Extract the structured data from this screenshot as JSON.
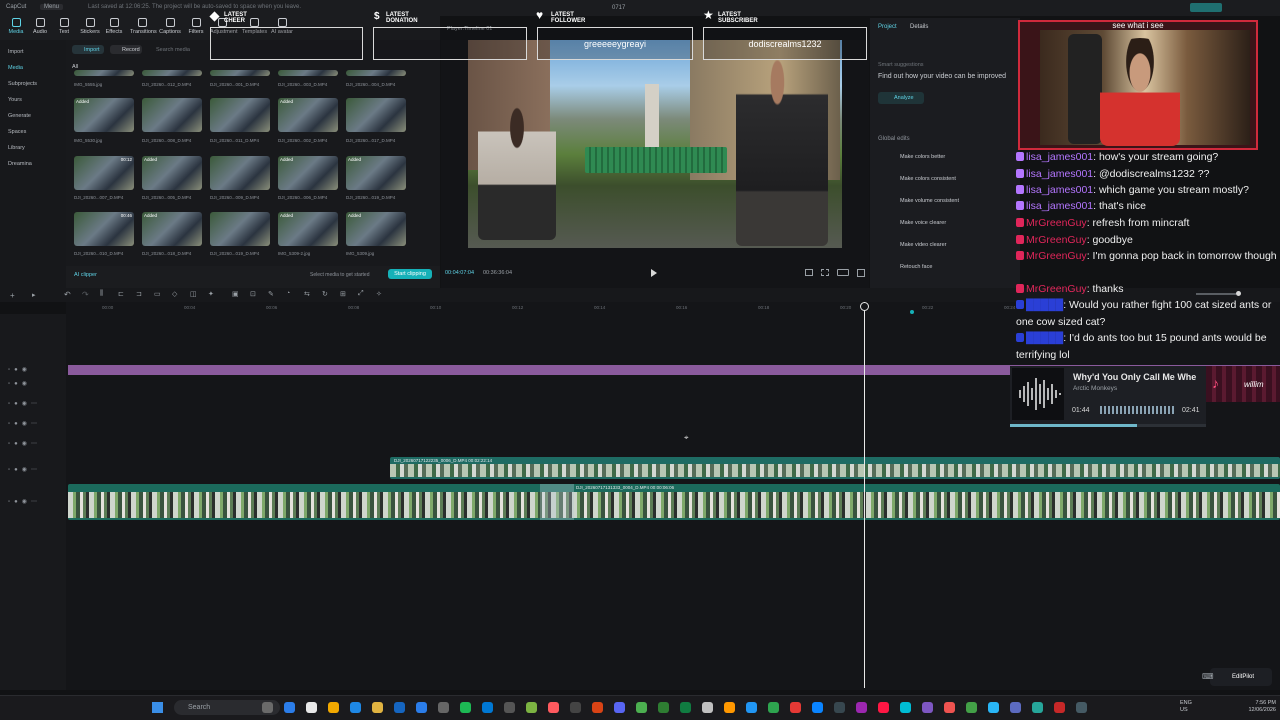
{
  "titlebar": {
    "app_name": "CapCut",
    "menu_label": "Menu",
    "notice": "Last saved at 12:06:25. The project will be auto-saved to space when you leave.",
    "timecode_small": "0717"
  },
  "toolbar": {
    "items": [
      "Media",
      "Audio",
      "Text",
      "Stickers",
      "Effects",
      "Transitions",
      "Captions",
      "Filters",
      "Adjustment",
      "Templates",
      "AI avatar"
    ]
  },
  "leftnav": {
    "items": [
      "Import",
      "Media",
      "Subprojects",
      "Yours",
      "Generate",
      "Spaces",
      "Library",
      "Dreamina"
    ]
  },
  "media": {
    "import_label": "Import",
    "record_label": "Record",
    "search_placeholder": "Search media",
    "filter_all": "All",
    "ai_clipper": "AI clipper",
    "select_hint": "Select media to get started",
    "start_clipping": "Start clipping",
    "thumbs": [
      {
        "caption": "IMG_5555.jpg",
        "tag": "",
        "dur": ""
      },
      {
        "caption": "DJI_20260...012_D.MP4",
        "tag": "",
        "dur": ""
      },
      {
        "caption": "DJI_20260...001_D.MP4",
        "tag": "",
        "dur": ""
      },
      {
        "caption": "DJI_20260...003_D.MP4",
        "tag": "",
        "dur": ""
      },
      {
        "caption": "DJI_20260...004_D.MP4",
        "tag": "",
        "dur": ""
      },
      {
        "caption": "IMG_5530.jpg",
        "tag": "Added",
        "dur": ""
      },
      {
        "caption": "DJI_20260...008_D.MP4",
        "tag": "",
        "dur": ""
      },
      {
        "caption": "DJI_20260...011_D.MP4",
        "tag": "",
        "dur": ""
      },
      {
        "caption": "DJI_20260...002_D.MP4",
        "tag": "Added",
        "dur": ""
      },
      {
        "caption": "DJI_20260...017_D.MP4",
        "tag": "",
        "dur": ""
      },
      {
        "caption": "DJI_20260...007_D.MP4",
        "tag": "",
        "dur": "00:12"
      },
      {
        "caption": "DJI_20260...005_D.MP4",
        "tag": "Added",
        "dur": ""
      },
      {
        "caption": "DJI_20260...009_D.MP4",
        "tag": "",
        "dur": ""
      },
      {
        "caption": "DJI_20260...006_D.MP4",
        "tag": "Added",
        "dur": ""
      },
      {
        "caption": "DJI_20260...019_D.MP4",
        "tag": "Added",
        "dur": ""
      },
      {
        "caption": "DJI_20260...010_D.MP4",
        "tag": "",
        "dur": "00:46"
      },
      {
        "caption": "DJI_20260...018_D.MP4",
        "tag": "Added",
        "dur": ""
      },
      {
        "caption": "DJI_20260...019_D.MP4",
        "tag": "",
        "dur": ""
      },
      {
        "caption": "IMG_5309-2.jpg",
        "tag": "Added",
        "dur": ""
      },
      {
        "caption": "IMG_5309.jpg",
        "tag": "Added",
        "dur": ""
      }
    ]
  },
  "player": {
    "title": "Player:Timeline 01",
    "current_time": "00:04:07:04",
    "total_time": "00:36:36:04"
  },
  "props": {
    "tab_project": "Project",
    "tab_details": "Details",
    "smart_suggestions": "Smart suggestions",
    "find_out": "Find out how your video can be improved",
    "analyze": "Analyze",
    "global_edits": "Global edits",
    "edits": [
      "Make colors better",
      "Make colors consistent",
      "Make volume consistent",
      "Make voice clearer",
      "Make video clearer",
      "Retouch face"
    ]
  },
  "timeline": {
    "clip1_label": "DJI_20260717122235_0006_D.MP4   00:02:22:14",
    "clip2_label": "DJI_20260717131333_0004_D.MP4   00:00:06:06",
    "ruler": [
      "00:00",
      "00:04",
      "00:06",
      "00:08",
      "00:10",
      "00:12",
      "00:14",
      "00:16",
      "00:18",
      "00:20",
      "00:22",
      "00:24"
    ]
  },
  "overlays": {
    "cheer_label": "LATEST CHEER",
    "donation_label": "LATEST DONATION",
    "follower_label": "LATEST FOLLOWER",
    "follower_value": "greeeeeygreayi",
    "subscriber_label": "LATEST SUBSCRIBER",
    "subscriber_value": "dodiscrealms1232",
    "webcam_caption": "see what i see"
  },
  "chat": [
    {
      "user": "lisa_james001",
      "badge": "",
      "msg": "how's your stream going?",
      "color": "#b476ff"
    },
    {
      "user": "lisa_james001",
      "badge": "",
      "msg": "@dodiscrealms1232 ??",
      "color": "#b476ff"
    },
    {
      "user": "lisa_james001",
      "badge": "",
      "msg": "which game you stream mostly?",
      "color": "#b476ff"
    },
    {
      "user": "lisa_james001",
      "badge": "",
      "msg": "that's nice",
      "color": "#b476ff"
    },
    {
      "user": "MrGreenGuy",
      "badge": "",
      "msg": "refresh from mincraft",
      "color": "#e0265a"
    },
    {
      "user": "MrGreenGuy",
      "badge": "",
      "msg": "goodbye",
      "color": "#e0265a"
    },
    {
      "user": "MrGreenGuy",
      "badge": "",
      "msg": "I'm gonna pop back in tomorrow though",
      "color": "#e0265a"
    },
    {
      "user": "MrGreenGuy",
      "badge": "",
      "msg": "thanks",
      "color": "#e0265a"
    },
    {
      "user": "",
      "badge": "",
      "msg": "Would you rather fight 100 cat sized ants or one cow sized cat?",
      "color": "#2a3fd6"
    },
    {
      "user": "",
      "badge": "",
      "msg": "I'd do ants too but 15 pound ants would be terrifying lol",
      "color": "#2a3fd6"
    }
  ],
  "music": {
    "title": "Why'd You Only Call Me Whe",
    "artist": "Arctic Monkeys",
    "elapsed": "01:44",
    "duration": "02:41",
    "progress": 0.65
  },
  "tiktok_name": "willim",
  "editpilot": "EditPilot",
  "taskbar": {
    "search_placeholder": "Search",
    "lang": "ENG",
    "region": "US",
    "time": "7:56 PM",
    "date": "12/06/2026"
  }
}
